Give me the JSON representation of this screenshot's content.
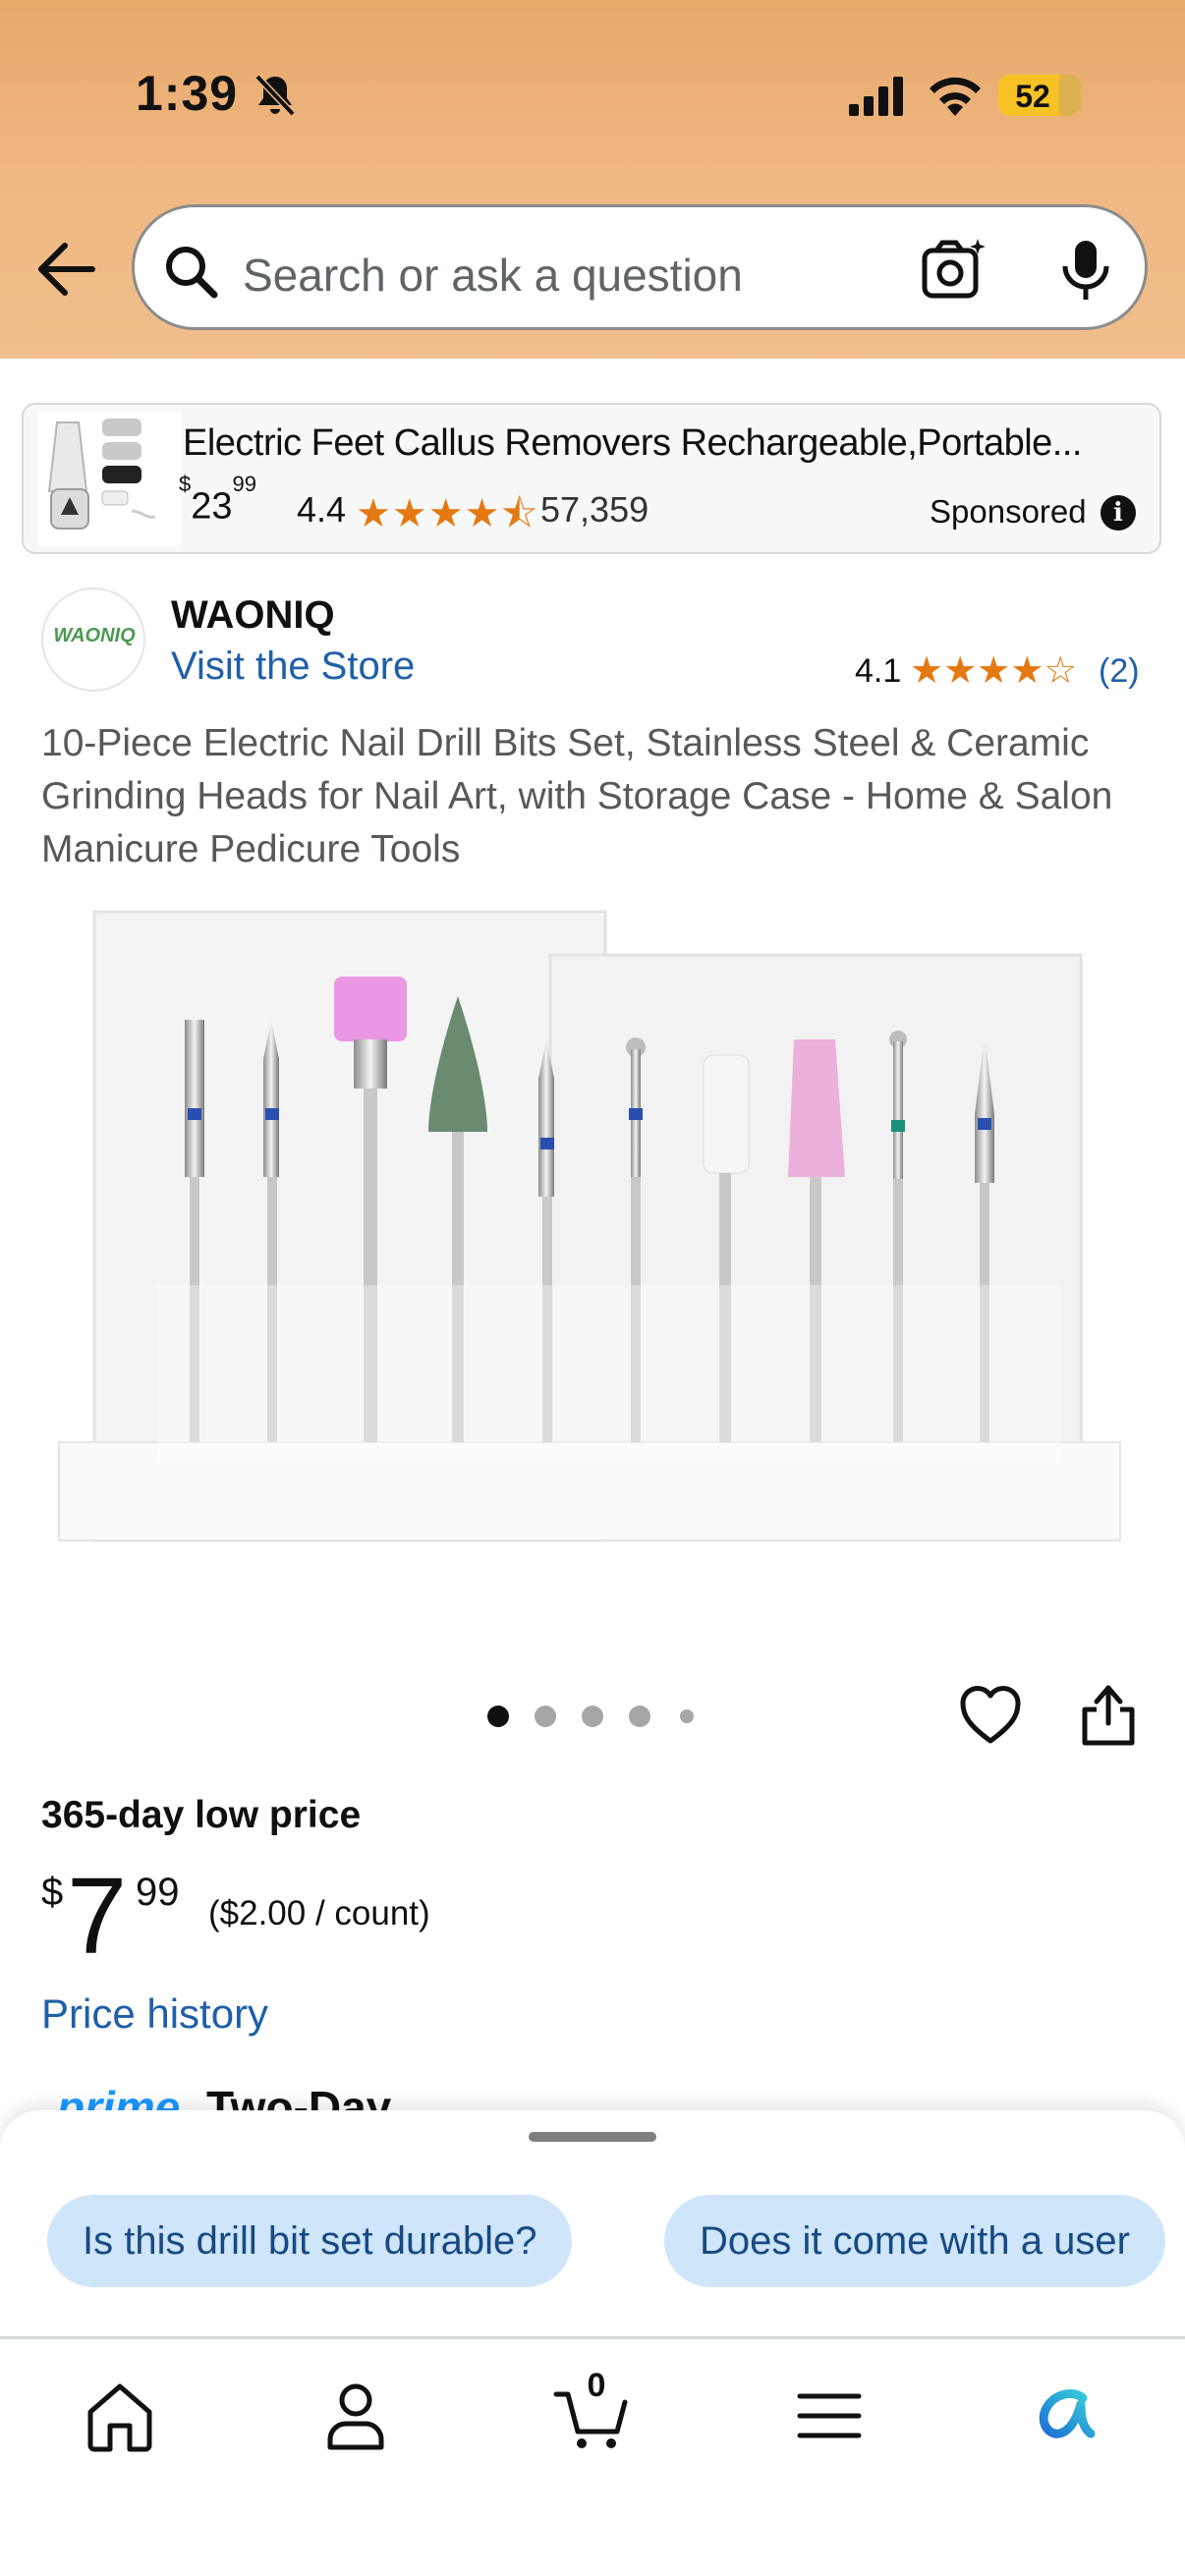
{
  "status_bar": {
    "time": "1:39",
    "battery": "52"
  },
  "search": {
    "placeholder": "Search or ask a question"
  },
  "sponsored_ad": {
    "title": "Electric Feet Callus Removers Rechargeable,Portable...",
    "price_symbol": "$",
    "price_whole": "23",
    "price_fraction": "99",
    "rating": "4.4",
    "stars": "★★★★⯪",
    "review_count": "57,359",
    "sponsored_label": "Sponsored"
  },
  "brand": {
    "logo_text": "WAONIQ",
    "name": "WAONIQ",
    "store_link": "Visit the Store",
    "rating": "4.1",
    "stars": "★★★★☆",
    "review_count": "(2)"
  },
  "product": {
    "title": "10-Piece Electric Nail Drill Bits Set, Stainless Steel & Ceramic Grinding Heads for Nail Art, with Storage Case - Home & Salon Manicure Pedicure Tools",
    "image_dots": {
      "count": 5,
      "active_index": 0
    },
    "deal_label": "365-day low price",
    "price_symbol": "$",
    "price_whole": "7",
    "price_fraction": "99",
    "per_count": "($2.00 / count)",
    "price_history": "Price history",
    "prime_label": "prime",
    "delivery_label": "Two-Day"
  },
  "suggestions": [
    "Is this drill bit set durable?",
    "Does it come with a user"
  ],
  "tabbar": {
    "items": [
      "home-icon",
      "account-icon",
      "cart-icon",
      "menu-icon",
      "rufus-icon"
    ],
    "cart_count": "0"
  },
  "colors": {
    "header": "#efb884",
    "link": "#1f5fa8",
    "stars": "#e47911",
    "chip": "#cfe5fa",
    "prime": "#1a98ff",
    "rufus": "#2b8fd6"
  }
}
